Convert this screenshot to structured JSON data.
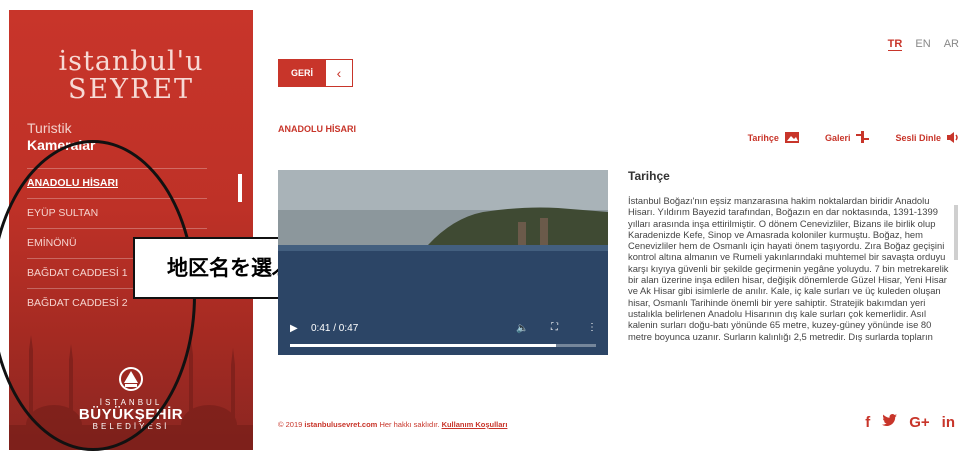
{
  "brand": {
    "line1": "istanbul'u",
    "line2": "SEYRET"
  },
  "sidebar": {
    "subtitle_1": "Turistik",
    "subtitle_2": "Kameralar",
    "items": [
      {
        "label": "ANADOLU HİSARI",
        "active": true
      },
      {
        "label": "EYÜP SULTAN"
      },
      {
        "label": "EMİNÖNÜ"
      },
      {
        "label": "BAĞDAT CADDESİ 1"
      },
      {
        "label": "BAĞDAT CADDESİ 2"
      }
    ],
    "ibb_small": "İSTANBUL",
    "ibb_big": "BÜYÜKŞEHİR",
    "ibb_sub": "BELEDİYESİ"
  },
  "annotation": "地区名を選ぶリスト",
  "languages": [
    "TR",
    "EN",
    "AR"
  ],
  "active_language": "TR",
  "back_label": "GERİ",
  "place_title": "ANADOLU HİSARI",
  "tabs": [
    {
      "label": "Tarihçe",
      "icon": "image-icon"
    },
    {
      "label": "Galeri",
      "icon": "gallery-icon"
    },
    {
      "label": "Sesli Dinle",
      "icon": "speaker-icon"
    }
  ],
  "video": {
    "time": "0:41 / 0:47",
    "progress": 0.87
  },
  "article": {
    "title": "Tarihçe",
    "body": "İstanbul Boğazı'nın eşsiz manzarasına hakim noktalardan biridir Anadolu Hisarı. Yıldırım Bayezid tarafından, Boğazın en dar noktasında, 1391-1399 yılları arasında inşa ettirilmiştir. O dönem Cenevizliler, Bizans ile birlik olup Karadenizde Kefe, Sinop ve Amasrada koloniler kurmuştu. Boğaz, hem Cenevizliler hem de Osmanlı için hayati önem taşıyordu. Zıra Boğaz geçişini kontrol altına almanın ve Rumeli yakınlarındaki muhtemel bir savaşta orduyu karşı kıyıya güvenli bir şekilde geçirmenin yegâne yoluydu. 7 bin metrekarelik bir alan üzerine inşa edilen hisar, değişik dönemlerde Güzel Hisar, Yeni Hisar ve Ak Hisar gibi isimlerle de anılır. Kale, iç kale surları ve üç kuleden oluşan hisar, Osmanlı Tarihinde önemli bir yere sahiptir. Stratejik bakımdan yeri ustalıkla belirlenen Anadolu Hisarının dış kale surları çok kemerlidir. Asıl kalenin surları doğu-batı yönünde 65 metre, kuzey-güney yönünde ise 80 metre boyunca uzanır. Surların kalınlığı 2,5 metredir. Dış surlarda topların"
  },
  "footer": {
    "prefix": "© 2019",
    "site": "istanbulusevret.com",
    "rights": "Her hakkı saklıdır.",
    "terms": "Kullanım Koşulları"
  },
  "social": [
    "f",
    "G+",
    "in"
  ]
}
